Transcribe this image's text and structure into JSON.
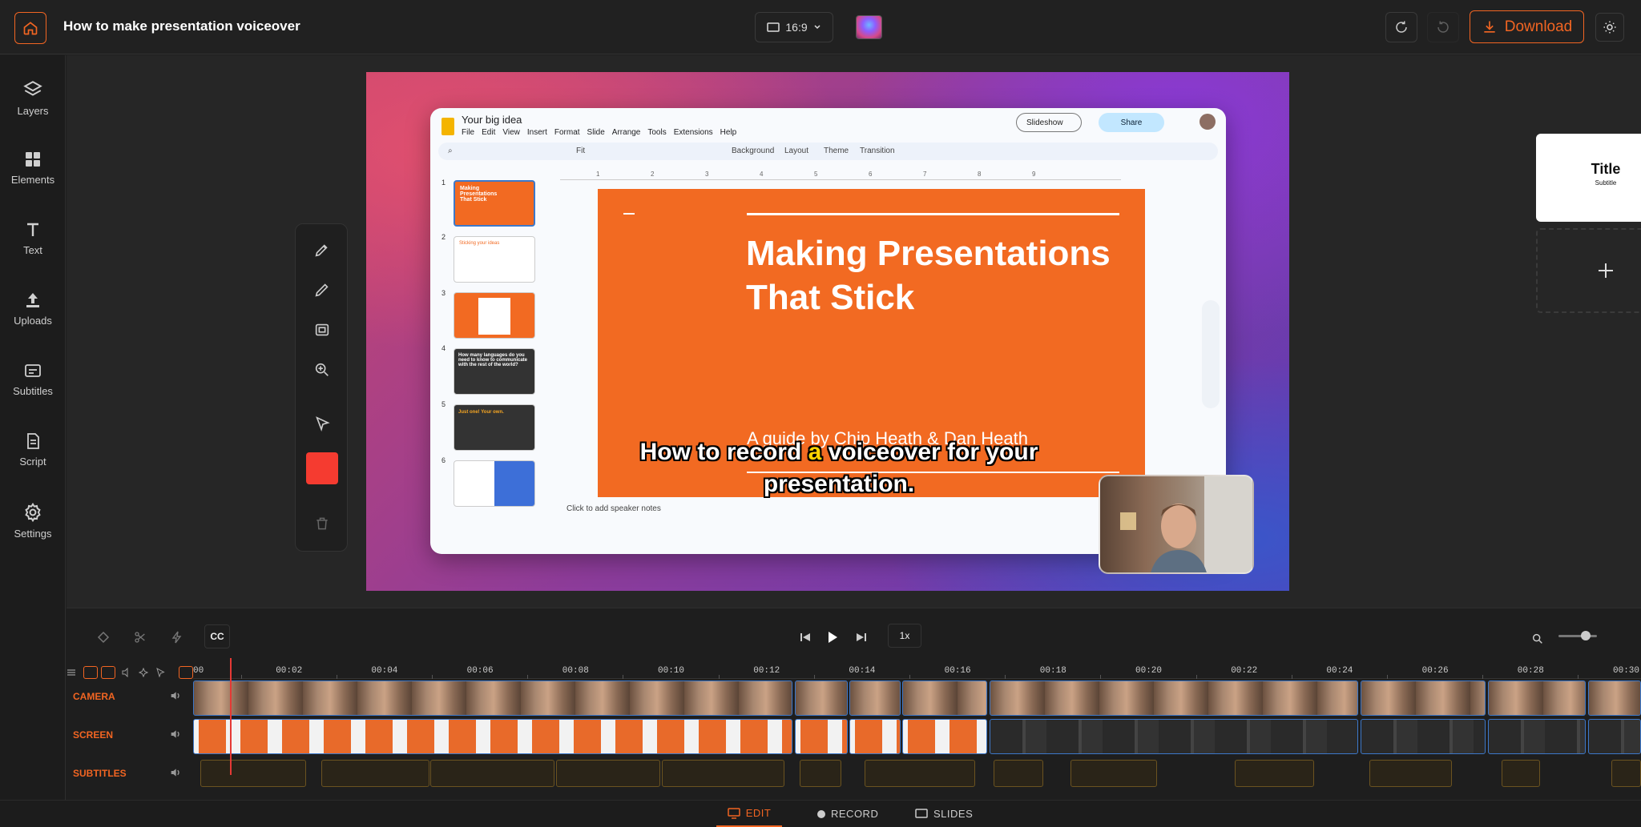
{
  "header": {
    "title": "How to make presentation voiceover",
    "aspect_ratio": "16:9",
    "download_label": "Download"
  },
  "sidebar": {
    "items": [
      {
        "label": "Layers",
        "icon": "layers-icon"
      },
      {
        "label": "Elements",
        "icon": "grid-icon"
      },
      {
        "label": "Text",
        "icon": "text-icon"
      },
      {
        "label": "Uploads",
        "icon": "upload-icon"
      },
      {
        "label": "Subtitles",
        "icon": "subtitles-icon"
      },
      {
        "label": "Script",
        "icon": "script-icon"
      },
      {
        "label": "Settings",
        "icon": "gear-icon"
      }
    ]
  },
  "google_slides": {
    "doc_title": "Your big idea",
    "menu": [
      "File",
      "Edit",
      "View",
      "Insert",
      "Format",
      "Slide",
      "Arrange",
      "Tools",
      "Extensions",
      "Help"
    ],
    "toolbar": {
      "zoom": "Fit",
      "background": "Background",
      "layout": "Layout",
      "theme": "Theme",
      "transition": "Transition"
    },
    "slideshow_label": "Slideshow",
    "share_label": "Share",
    "ruler_numbers": [
      "1",
      "2",
      "3",
      "4",
      "5",
      "6",
      "7",
      "8",
      "9"
    ],
    "thumbnails": [
      {
        "num": "1",
        "text": "Making Presentations That Stick"
      },
      {
        "num": "2",
        "text": "Sticking your ideas"
      },
      {
        "num": "3",
        "text": ""
      },
      {
        "num": "4",
        "text": "How many languages do you need to know to communicate with the rest of the world?"
      },
      {
        "num": "5",
        "text": "Just one! Your own."
      },
      {
        "num": "6",
        "text": ""
      }
    ],
    "slide_heading": "Making Presentations That Stick",
    "slide_subtitle": "A guide by Chip Heath & Dan Heath",
    "speaker_notes_placeholder": "Click to add speaker notes"
  },
  "overlay_subtitle": {
    "before": "How to record ",
    "highlight": "a",
    "after": " voiceover for your presentation."
  },
  "slide_list": {
    "title": "Title",
    "subtitle": "Subtitle"
  },
  "timeline": {
    "cc_label": "CC",
    "speed": "1x",
    "ticks": [
      "00",
      "00:02",
      "00:04",
      "00:06",
      "00:08",
      "00:10",
      "00:12",
      "00:14",
      "00:16",
      "00:18",
      "00:20",
      "00:22",
      "00:24",
      "00:26",
      "00:28",
      "00:30"
    ],
    "tracks": [
      "CAMERA",
      "SCREEN",
      "SUBTITLES"
    ],
    "zoom_level": 0.7
  },
  "bottom_tabs": [
    "EDIT",
    "RECORD",
    "SLIDES"
  ],
  "colors": {
    "accent": "#f26522",
    "clip_border": "#3d78c9",
    "playhead": "#e53935"
  }
}
